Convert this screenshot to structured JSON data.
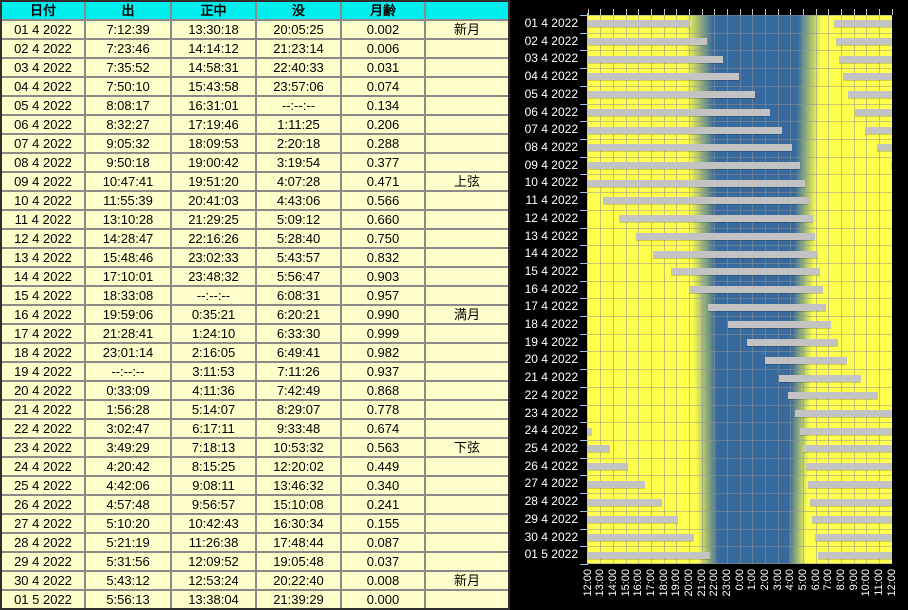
{
  "table": {
    "headers": [
      "日付",
      "出",
      "正中",
      "没",
      "月齢",
      ""
    ],
    "rows": [
      {
        "date": "01 4 2022",
        "rise": "7:12:39",
        "transit": "13:30:18",
        "set": "20:05:25",
        "age": "0.002",
        "phase": "新月"
      },
      {
        "date": "02 4 2022",
        "rise": "7:23:46",
        "transit": "14:14:12",
        "set": "21:23:14",
        "age": "0.006",
        "phase": ""
      },
      {
        "date": "03 4 2022",
        "rise": "7:35:52",
        "transit": "14:58:31",
        "set": "22:40:33",
        "age": "0.031",
        "phase": ""
      },
      {
        "date": "04 4 2022",
        "rise": "7:50:10",
        "transit": "15:43:58",
        "set": "23:57:06",
        "age": "0.074",
        "phase": ""
      },
      {
        "date": "05 4 2022",
        "rise": "8:08:17",
        "transit": "16:31:01",
        "set": "--:--:--",
        "age": "0.134",
        "phase": ""
      },
      {
        "date": "06 4 2022",
        "rise": "8:32:27",
        "transit": "17:19:46",
        "set": "1:11:25",
        "age": "0.206",
        "phase": ""
      },
      {
        "date": "07 4 2022",
        "rise": "9:05:32",
        "transit": "18:09:53",
        "set": "2:20:18",
        "age": "0.288",
        "phase": ""
      },
      {
        "date": "08 4 2022",
        "rise": "9:50:18",
        "transit": "19:00:42",
        "set": "3:19:54",
        "age": "0.377",
        "phase": ""
      },
      {
        "date": "09 4 2022",
        "rise": "10:47:41",
        "transit": "19:51:20",
        "set": "4:07:28",
        "age": "0.471",
        "phase": "上弦"
      },
      {
        "date": "10 4 2022",
        "rise": "11:55:39",
        "transit": "20:41:03",
        "set": "4:43:06",
        "age": "0.566",
        "phase": ""
      },
      {
        "date": "11 4 2022",
        "rise": "13:10:28",
        "transit": "21:29:25",
        "set": "5:09:12",
        "age": "0.660",
        "phase": ""
      },
      {
        "date": "12 4 2022",
        "rise": "14:28:47",
        "transit": "22:16:26",
        "set": "5:28:40",
        "age": "0.750",
        "phase": ""
      },
      {
        "date": "13 4 2022",
        "rise": "15:48:46",
        "transit": "23:02:33",
        "set": "5:43:57",
        "age": "0.832",
        "phase": ""
      },
      {
        "date": "14 4 2022",
        "rise": "17:10:01",
        "transit": "23:48:32",
        "set": "5:56:47",
        "age": "0.903",
        "phase": ""
      },
      {
        "date": "15 4 2022",
        "rise": "18:33:08",
        "transit": "--:--:--",
        "set": "6:08:31",
        "age": "0.957",
        "phase": ""
      },
      {
        "date": "16 4 2022",
        "rise": "19:59:06",
        "transit": "0:35:21",
        "set": "6:20:21",
        "age": "0.990",
        "phase": "満月"
      },
      {
        "date": "17 4 2022",
        "rise": "21:28:41",
        "transit": "1:24:10",
        "set": "6:33:30",
        "age": "0.999",
        "phase": ""
      },
      {
        "date": "18 4 2022",
        "rise": "23:01:14",
        "transit": "2:16:05",
        "set": "6:49:41",
        "age": "0.982",
        "phase": ""
      },
      {
        "date": "19 4 2022",
        "rise": "--:--:--",
        "transit": "3:11:53",
        "set": "7:11:26",
        "age": "0.937",
        "phase": ""
      },
      {
        "date": "20 4 2022",
        "rise": "0:33:09",
        "transit": "4:11:36",
        "set": "7:42:49",
        "age": "0.868",
        "phase": ""
      },
      {
        "date": "21 4 2022",
        "rise": "1:56:28",
        "transit": "5:14:07",
        "set": "8:29:07",
        "age": "0.778",
        "phase": ""
      },
      {
        "date": "22 4 2022",
        "rise": "3:02:47",
        "transit": "6:17:11",
        "set": "9:33:48",
        "age": "0.674",
        "phase": ""
      },
      {
        "date": "23 4 2022",
        "rise": "3:49:29",
        "transit": "7:18:13",
        "set": "10:53:32",
        "age": "0.563",
        "phase": "下弦"
      },
      {
        "date": "24 4 2022",
        "rise": "4:20:42",
        "transit": "8:15:25",
        "set": "12:20:02",
        "age": "0.449",
        "phase": ""
      },
      {
        "date": "25 4 2022",
        "rise": "4:42:06",
        "transit": "9:08:11",
        "set": "13:46:32",
        "age": "0.340",
        "phase": ""
      },
      {
        "date": "26 4 2022",
        "rise": "4:57:48",
        "transit": "9:56:57",
        "set": "15:10:08",
        "age": "0.241",
        "phase": ""
      },
      {
        "date": "27 4 2022",
        "rise": "5:10:20",
        "transit": "10:42:43",
        "set": "16:30:34",
        "age": "0.155",
        "phase": ""
      },
      {
        "date": "28 4 2022",
        "rise": "5:21:19",
        "transit": "11:26:38",
        "set": "17:48:44",
        "age": "0.087",
        "phase": ""
      },
      {
        "date": "29 4 2022",
        "rise": "5:31:56",
        "transit": "12:09:52",
        "set": "19:05:48",
        "age": "0.037",
        "phase": ""
      },
      {
        "date": "30 4 2022",
        "rise": "5:43:12",
        "transit": "12:53:24",
        "set": "20:22:40",
        "age": "0.008",
        "phase": "新月"
      },
      {
        "date": "01 5 2022",
        "rise": "5:56:13",
        "transit": "13:38:04",
        "set": "21:39:29",
        "age": "0.000",
        "phase": ""
      }
    ]
  },
  "chart_data": {
    "type": "timeline-bar",
    "description": "Per-day horizontal bars mark when the moon is above the horizon (computed from rise/set times in table.rows); each row spans noon to noon of the next day; yellow background = daylight, blue = night with twilight gradients",
    "row_labels_source": "table.rows[].date",
    "x_tick_labels": [
      "12:00",
      "13:00",
      "14:00",
      "15:00",
      "16:00",
      "17:00",
      "18:00",
      "19:00",
      "20:00",
      "21:00",
      "22:00",
      "23:00",
      "0:00",
      "1:00",
      "2:00",
      "3:00",
      "4:00",
      "5:00",
      "6:00",
      "7:00",
      "8:00",
      "9:00",
      "10:00",
      "11:00",
      "12:00"
    ],
    "axis_span_hours": 24,
    "next_day_rise_estimate": "6:09:00",
    "twilight_clock_hours": {
      "first_row": [
        19.66,
        21.87,
        28.58,
        30.47
      ],
      "last_row": [
        20.68,
        22.26,
        27.79,
        29.21
      ]
    },
    "grid": true,
    "legend": "none",
    "colors": {
      "day": "#ffff4d",
      "night": "#376a9e",
      "bar": "#c3c3c3",
      "axis": "#a9c6e4",
      "labels": "#ffffff",
      "background": "#000000",
      "table_cell": "#ffffcc",
      "table_header": "#00eeee",
      "table_grid": "#8a8a8a"
    }
  }
}
